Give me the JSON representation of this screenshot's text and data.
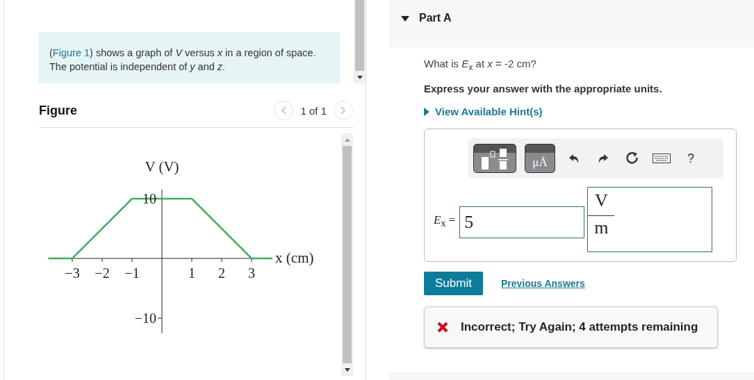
{
  "intro": {
    "prefix": "(",
    "link": "Figure 1",
    "text": ") shows a graph of *V* versus *x* in a region of space. The potential is independent of *y* and *z*."
  },
  "figure": {
    "title": "Figure",
    "pager": "1 of 1",
    "chart_data": {
      "type": "line",
      "xlabel": "x (cm)",
      "ylabel": "V (V)",
      "x": [
        -3.8,
        -3,
        -1,
        1,
        3,
        3.7
      ],
      "series": [
        {
          "color": "#3fae5a",
          "values": [
            0,
            0,
            10,
            10,
            0,
            0
          ]
        }
      ],
      "xlim": [
        -3.8,
        3.7
      ],
      "ylim": [
        -12.5,
        11.5
      ],
      "xticks": [
        {
          "value": -3,
          "label": "−3"
        },
        {
          "value": -2,
          "label": "−2"
        },
        {
          "value": -1,
          "label": "−1"
        },
        {
          "value": 1,
          "label": "1"
        },
        {
          "value": 2,
          "label": "2"
        },
        {
          "value": 3,
          "label": "3"
        }
      ],
      "yticks": [
        {
          "value": 10,
          "label": "10"
        },
        {
          "value": -10,
          "label": "−10"
        }
      ]
    }
  },
  "part": {
    "title": "Part A",
    "expanded": true
  },
  "question": "What is *E*$_{x}$ at *x* = -2 cm?",
  "instruction": "Express your answer with the appropriate units.",
  "hints": {
    "label": "View Available Hint(s)",
    "expanded": false
  },
  "toolbar": {
    "units_label": "μÅ",
    "help_label": "?"
  },
  "answer": {
    "label": "*E*$_{x}$ =",
    "value": "5",
    "unit_numerator": "V",
    "unit_denominator": "m"
  },
  "submit": "Submit",
  "previous": "Previous Answers",
  "feedback": {
    "kind": "incorrect",
    "text": "Incorrect; Try Again; 4 attempts remaining"
  }
}
